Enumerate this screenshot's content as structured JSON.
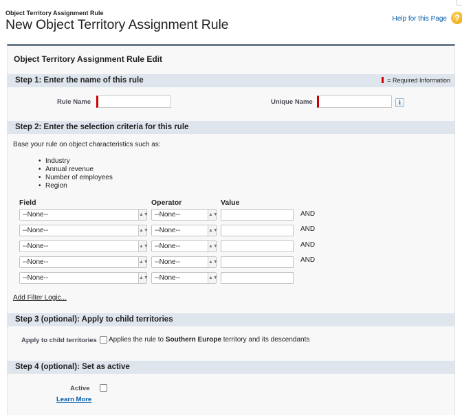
{
  "header": {
    "eyebrow": "Object Territory Assignment Rule",
    "title": "New Object Territory Assignment Rule",
    "help_link": "Help for this Page",
    "help_icon": "help-circle-icon"
  },
  "panel": {
    "title": "Object Territory Assignment Rule Edit"
  },
  "step1": {
    "title": "Step 1: Enter the name of this rule",
    "required_legend": "= Required Information",
    "rule_name_label": "Rule Name",
    "rule_name_value": "",
    "unique_name_label": "Unique Name",
    "unique_name_value": "",
    "info_icon": "i"
  },
  "step2": {
    "title": "Step 2: Enter the selection criteria for this rule",
    "intro": "Base your rule on object characteristics such as:",
    "examples": [
      "Industry",
      "Annual revenue",
      "Number of employees",
      "Region"
    ],
    "columns": {
      "field": "Field",
      "operator": "Operator",
      "value": "Value"
    },
    "rows": [
      {
        "field": "--None--",
        "operator": "--None--",
        "value": "",
        "conjunction": "AND"
      },
      {
        "field": "--None--",
        "operator": "--None--",
        "value": "",
        "conjunction": "AND"
      },
      {
        "field": "--None--",
        "operator": "--None--",
        "value": "",
        "conjunction": "AND"
      },
      {
        "field": "--None--",
        "operator": "--None--",
        "value": "",
        "conjunction": "AND"
      },
      {
        "field": "--None--",
        "operator": "--None--",
        "value": "",
        "conjunction": ""
      }
    ],
    "filter_logic_link": "Add Filter Logic..."
  },
  "step3": {
    "title": "Step 3 (optional): Apply to child territories",
    "label": "Apply to child territories",
    "text_before": "Applies the rule to ",
    "territory": "Southern Europe",
    "text_after": " territory and its descendants",
    "checked": false
  },
  "step4": {
    "title": "Step 4 (optional): Set as active",
    "active_label": "Active",
    "learn_more": "Learn More",
    "checked": false
  },
  "colors": {
    "required": "#cc0000",
    "section_bar": "#dfe5ed",
    "panel_border": "#6b7a8b",
    "link": "#015ba7"
  }
}
